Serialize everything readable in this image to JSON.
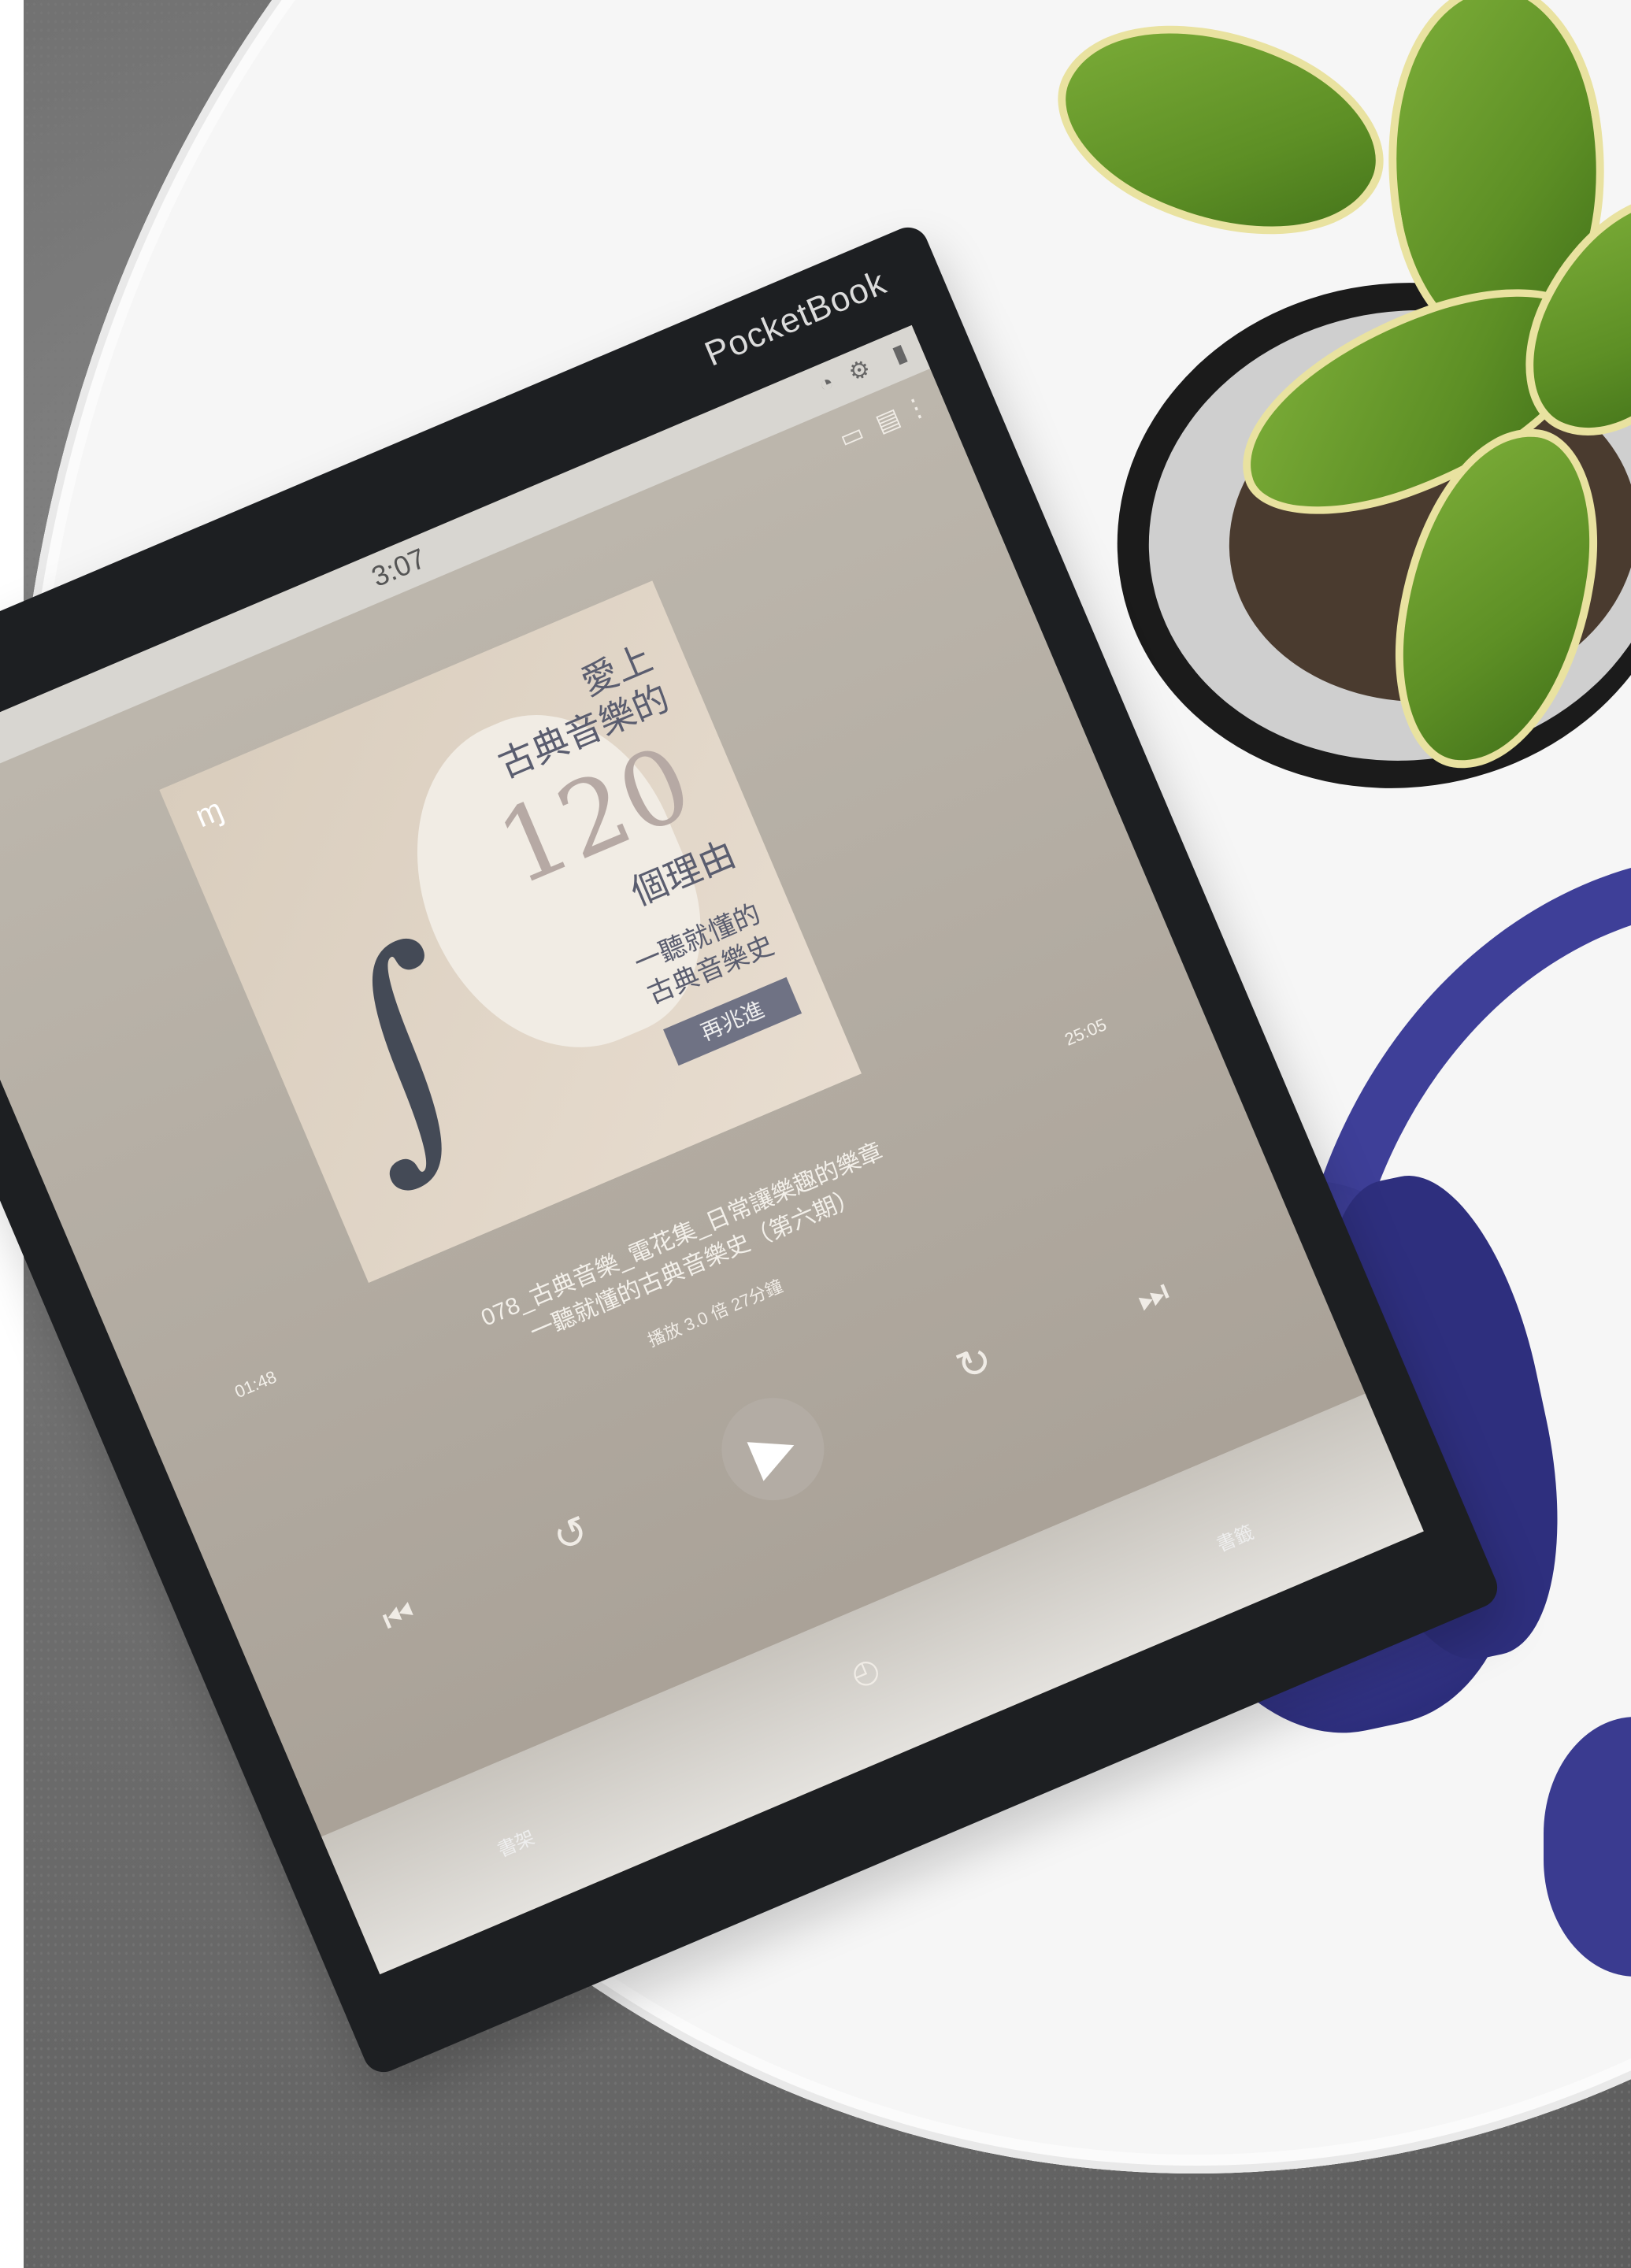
{
  "device": {
    "brand": "PocketBook"
  },
  "screen": {
    "status_time": "3:07",
    "cover": {
      "title_line1": "愛上",
      "title_line2": "古典音樂的",
      "number": "120",
      "title_line3": "個理由",
      "subtitle_line1": "一聽就懂的",
      "subtitle_line2": "古典音樂史",
      "button": "再兆進"
    },
    "track_title_line1": "078_古典音樂_電花集_日常讓樂趣的樂章",
    "track_title_line2": "一聽就懂的古典音樂史（第六期）",
    "track_meta": "播放 3.0 倍 27分鐘",
    "time_elapsed": "01:48",
    "time_total": "25:05",
    "bottom_left_label": "書架",
    "bottom_right_label": "書籤"
  },
  "colors": {
    "device_frame": "#1d1f22",
    "headphones": "#3e3f98",
    "leaf": "#6a9f2c"
  }
}
